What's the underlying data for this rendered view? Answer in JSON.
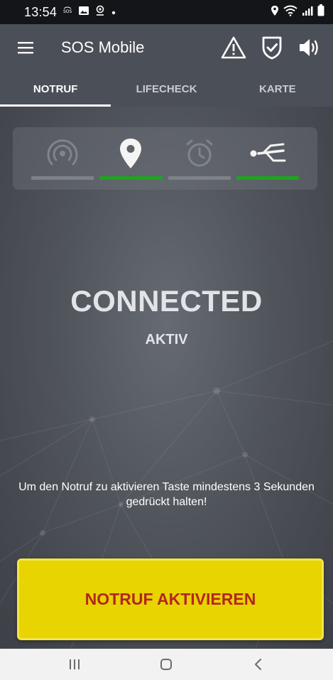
{
  "status_bar": {
    "time": "13:54",
    "left_icons": [
      "sos-icon",
      "image-icon",
      "location-icon",
      "dot-icon"
    ],
    "right_icons": [
      "location-icon",
      "wifi-icon",
      "signal-icon",
      "battery-icon"
    ]
  },
  "app_bar": {
    "title": "SOS Mobile",
    "actions": [
      "warning-icon",
      "shield-check-icon",
      "volume-icon"
    ]
  },
  "tabs": [
    {
      "label": "NOTRUF",
      "active": true
    },
    {
      "label": "LIFECHECK",
      "active": false
    },
    {
      "label": "KARTE",
      "active": false
    }
  ],
  "indicators": [
    {
      "icon": "radio-signal-icon",
      "active": false
    },
    {
      "icon": "location-pin-icon",
      "active": true
    },
    {
      "icon": "alarm-clock-icon",
      "active": false
    },
    {
      "icon": "man-down-icon",
      "active": true
    }
  ],
  "colors": {
    "indicator_active": "#1fa31f",
    "indicator_inactive": "#7d8188",
    "button_bg": "#e8d400",
    "button_text": "#b3261e"
  },
  "main": {
    "connection_status": "CONNECTED",
    "mode": "AKTIV",
    "hint": "Um den Notruf zu aktivieren Taste mindestens 3 Sekunden gedrückt halten!",
    "sos_button_label": "NOTRUF AKTIVIEREN"
  },
  "nav_bar": [
    "recent-apps-icon",
    "home-icon",
    "back-icon"
  ]
}
